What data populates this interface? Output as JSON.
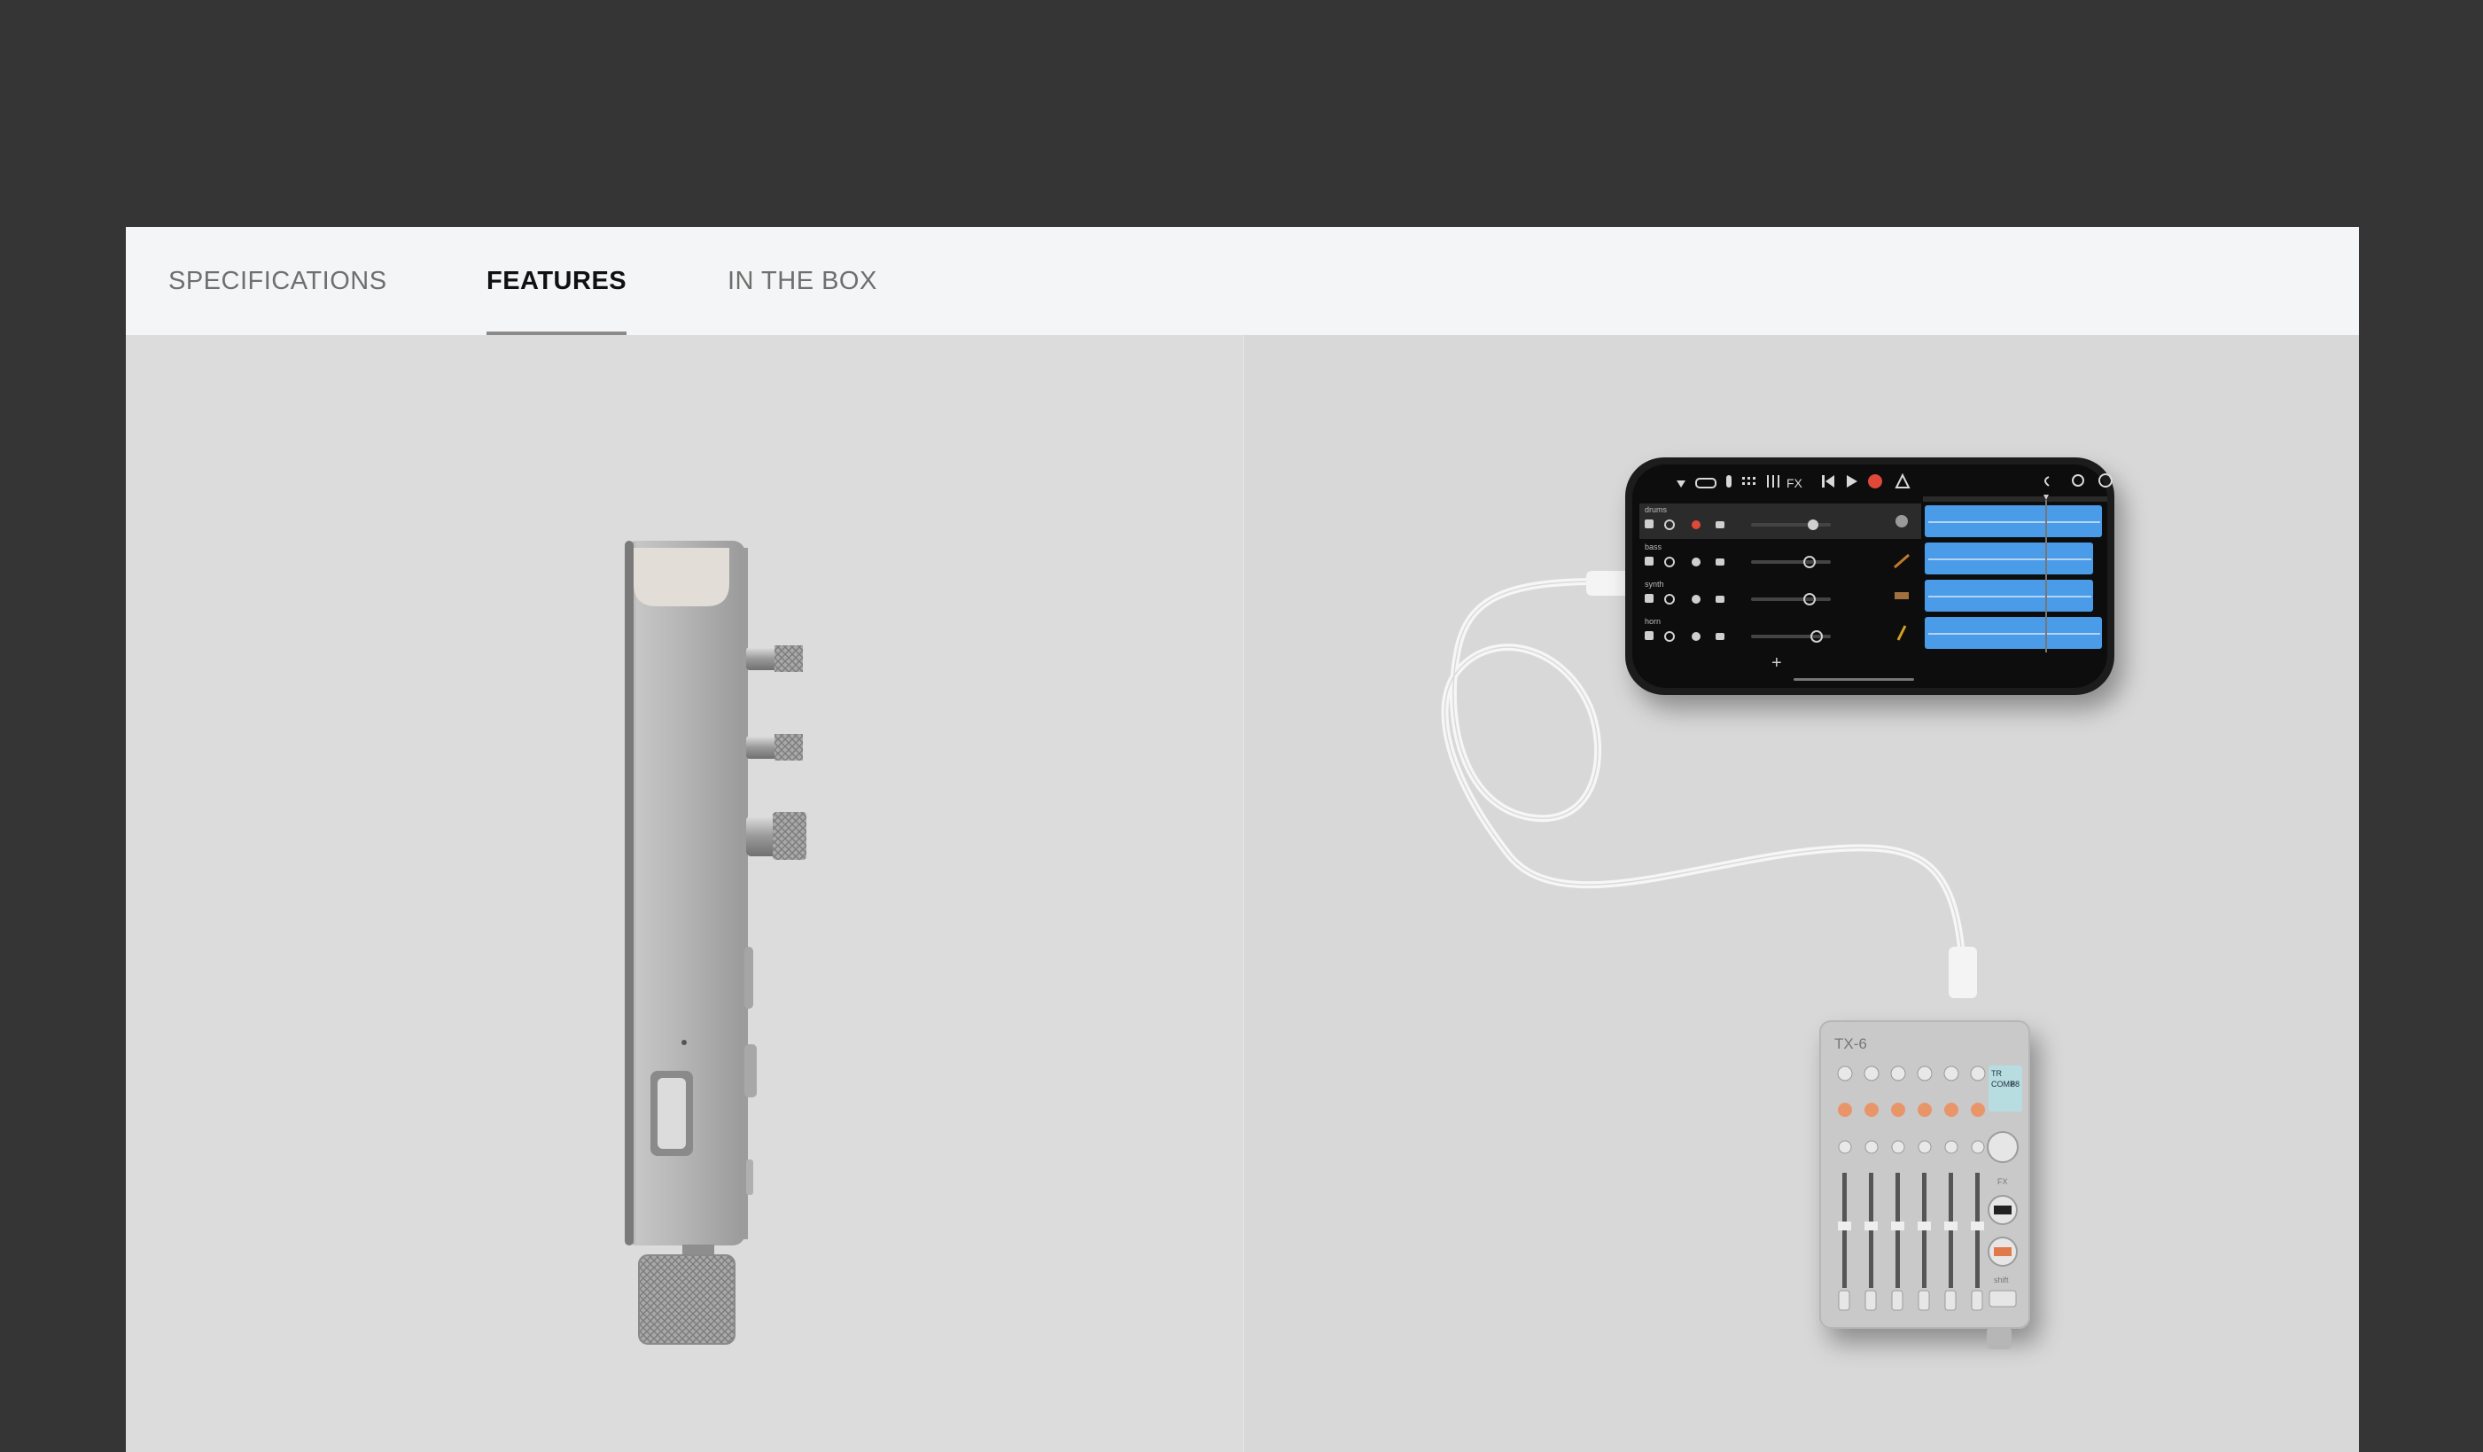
{
  "tabs": [
    {
      "label": "SPECIFICATIONS",
      "active": false
    },
    {
      "label": "FEATURES",
      "active": true
    },
    {
      "label": "IN THE BOX",
      "active": false
    }
  ],
  "device": {
    "model_label": "TX-6",
    "fx_label": "FX",
    "shift_label": "shift",
    "screen_lines": [
      "TR",
      "COMP",
      "88"
    ]
  },
  "phone_app": {
    "toolbar_fx": "FX",
    "tracks": [
      {
        "name": "drums"
      },
      {
        "name": "bass"
      },
      {
        "name": "synth"
      },
      {
        "name": "horn"
      }
    ],
    "add_symbol": "+"
  },
  "colors": {
    "page_bg": "#353535",
    "tab_bar_bg": "#f4f5f6",
    "image_bg": "#dcdcdc",
    "region_blue": "#4a9be8",
    "record_red": "#e0483a"
  }
}
